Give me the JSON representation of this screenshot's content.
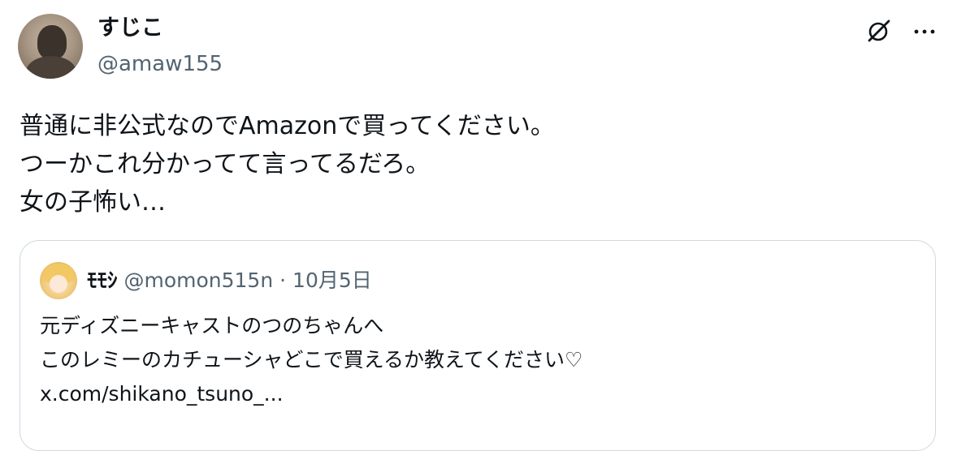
{
  "tweet": {
    "display_name": "すじこ",
    "handle": "@amaw155",
    "text_lines": [
      "普通に非公式なのでAmazonで買ってください。",
      "つーかこれ分かってて言ってるだろ。",
      "女の子怖い…"
    ],
    "icons": {
      "grok": "grok-icon",
      "more": "more-icon"
    }
  },
  "quote": {
    "display_name": "ﾓﾓｼ",
    "handle": "@momon515n",
    "separator": "·",
    "date": "10月5日",
    "text_lines": [
      "元ディズニーキャストのつのちゃんへ",
      "このレミーのカチューシャどこで買えるか教えてください♡",
      "x.com/shikano_tsuno_..."
    ]
  },
  "colors": {
    "text_primary": "#0f1419",
    "text_secondary": "#536471",
    "border": "#cfd9de"
  }
}
